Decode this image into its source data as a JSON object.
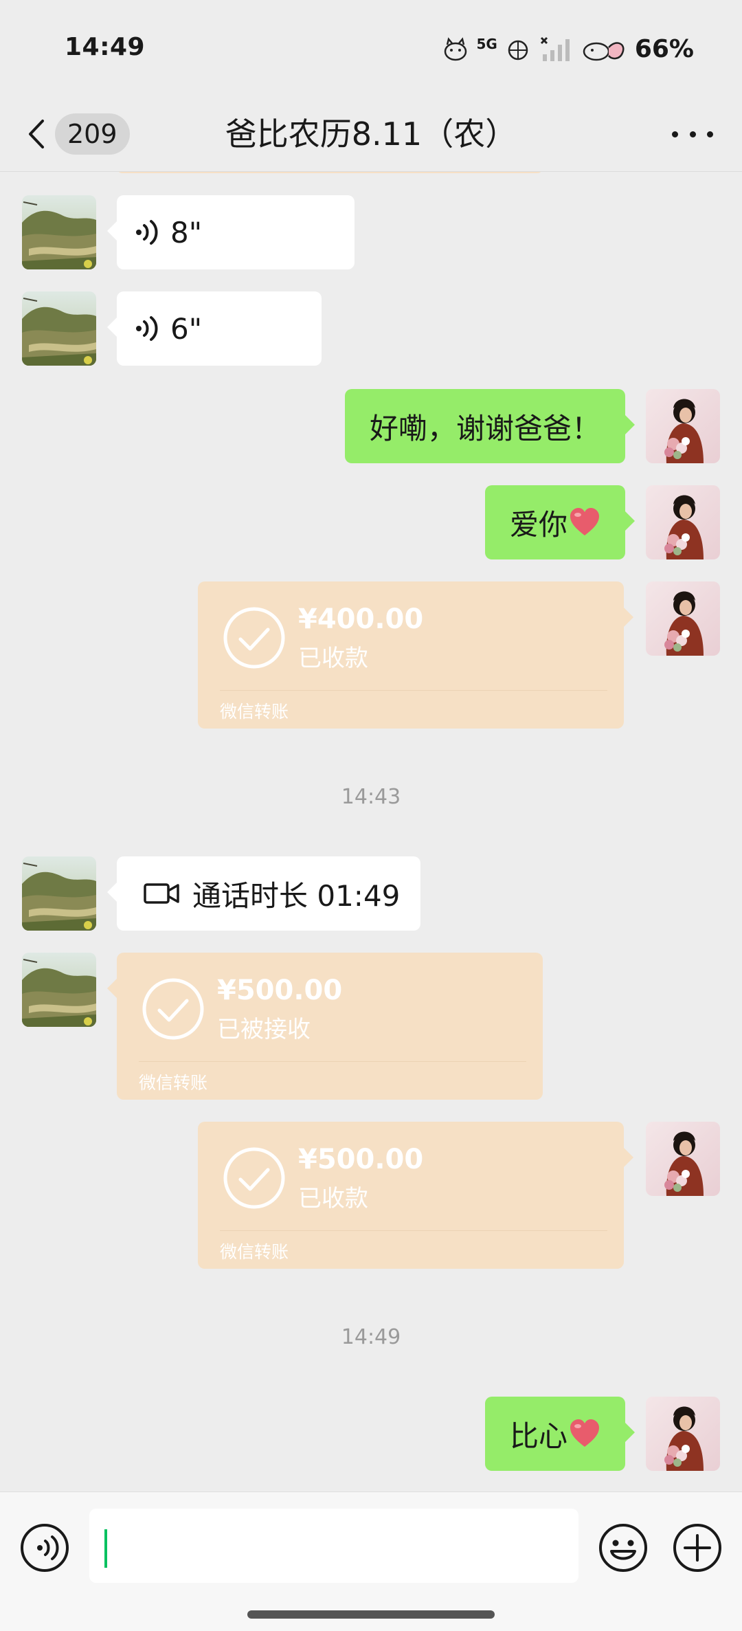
{
  "status_bar": {
    "time": "14:49",
    "network": "5G",
    "battery": "66%"
  },
  "nav": {
    "unread_count": "209",
    "title": "爸比农历8.11（农）"
  },
  "messages": {
    "voice1": {
      "duration": "8\""
    },
    "voice2": {
      "duration": "6\""
    },
    "text1": {
      "text": "好嘞，谢谢爸爸！"
    },
    "text2": {
      "text": "爱你"
    },
    "transfer1": {
      "amount": "¥400.00",
      "status": "已收款",
      "label": "微信转账"
    },
    "time1": "14:43",
    "call": {
      "text": "通话时长 01:49"
    },
    "transfer2": {
      "amount": "¥500.00",
      "status": "已被接收",
      "label": "微信转账"
    },
    "transfer3": {
      "amount": "¥500.00",
      "status": "已收款",
      "label": "微信转账"
    },
    "time2": "14:49",
    "text3": {
      "text": "比心"
    }
  },
  "input": {
    "value": "",
    "icons": [
      "voice-icon",
      "emoji-icon",
      "plus-icon"
    ]
  },
  "colors": {
    "background": "#ededed",
    "my_bubble": "#95ec69",
    "their_bubble": "#ffffff",
    "transfer_bubble": "#f6e0c5",
    "caret": "#07c160"
  }
}
